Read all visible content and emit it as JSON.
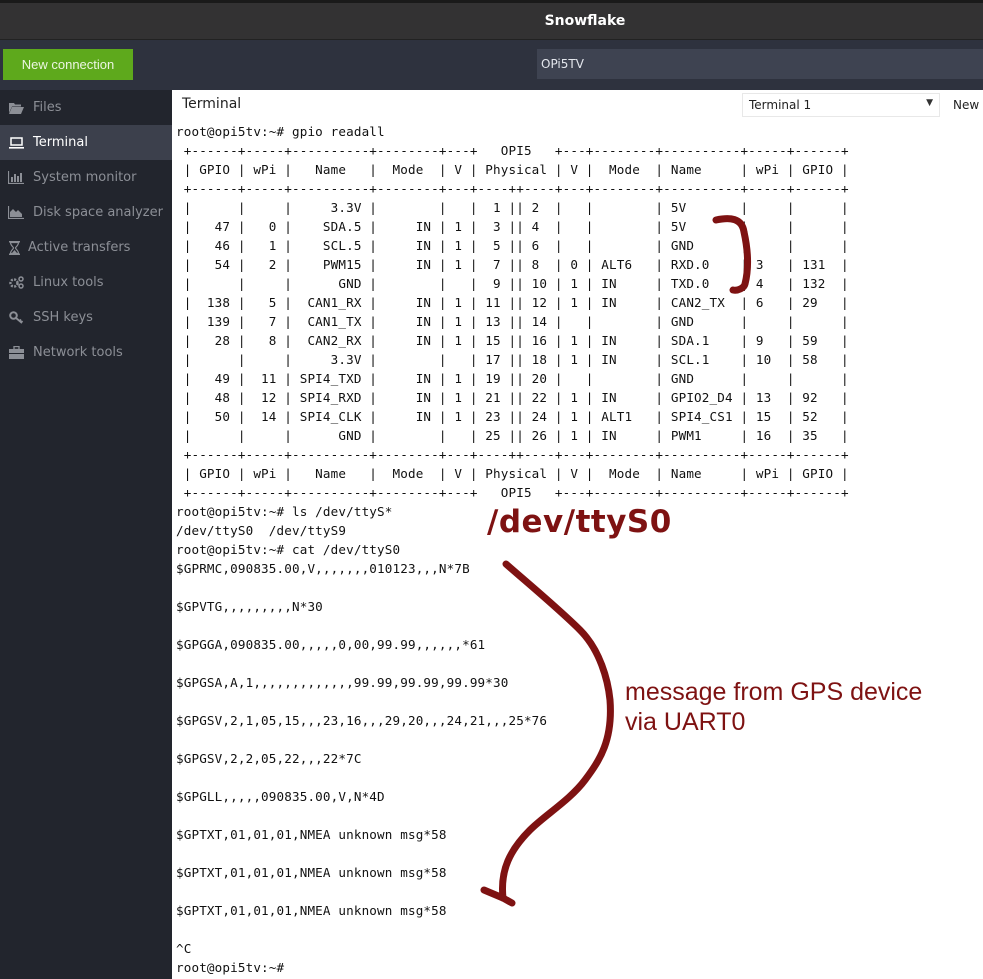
{
  "window": {
    "title": "Snowflake"
  },
  "toolbar": {
    "new_connection_label": "New connection",
    "session_name": "OPi5TV"
  },
  "sidebar": {
    "items": [
      {
        "label": "Files",
        "icon": "folder-open-icon",
        "active": false
      },
      {
        "label": "Terminal",
        "icon": "laptop-icon",
        "active": true
      },
      {
        "label": "System monitor",
        "icon": "bar-chart-icon",
        "active": false
      },
      {
        "label": "Disk space analyzer",
        "icon": "area-chart-icon",
        "active": false
      },
      {
        "label": "Active transfers",
        "icon": "hourglass-icon",
        "active": false
      },
      {
        "label": "Linux tools",
        "icon": "gears-icon",
        "active": false
      },
      {
        "label": "SSH keys",
        "icon": "key-icon",
        "active": false
      },
      {
        "label": "Network tools",
        "icon": "briefcase-icon",
        "active": false
      }
    ]
  },
  "main": {
    "tab_title": "Terminal",
    "terminal_select": "Terminal 1",
    "new_terminal_label": "New"
  },
  "terminal": {
    "lines": [
      "root@opi5tv:~# gpio readall",
      " +------+-----+----------+--------+---+   OPI5   +---+--------+----------+-----+------+",
      " | GPIO | wPi |   Name   |  Mode  | V | Physical | V |  Mode  | Name     | wPi | GPIO |",
      " +------+-----+----------+--------+---+----++----+---+--------+----------+-----+------+",
      " |      |     |     3.3V |        |   |  1 || 2  |   |        | 5V       |     |      |",
      " |   47 |   0 |    SDA.5 |     IN | 1 |  3 || 4  |   |        | 5V       |     |      |",
      " |   46 |   1 |    SCL.5 |     IN | 1 |  5 || 6  |   |        | GND      |     |      |",
      " |   54 |   2 |    PWM15 |     IN | 1 |  7 || 8  | 0 | ALT6   | RXD.0    | 3   | 131  |",
      " |      |     |      GND |        |   |  9 || 10 | 1 | IN     | TXD.0    | 4   | 132  |",
      " |  138 |   5 |  CAN1_RX |     IN | 1 | 11 || 12 | 1 | IN     | CAN2_TX  | 6   | 29   |",
      " |  139 |   7 |  CAN1_TX |     IN | 1 | 13 || 14 |   |        | GND      |     |      |",
      " |   28 |   8 |  CAN2_RX |     IN | 1 | 15 || 16 | 1 | IN     | SDA.1    | 9   | 59   |",
      " |      |     |     3.3V |        |   | 17 || 18 | 1 | IN     | SCL.1    | 10  | 58   |",
      " |   49 |  11 | SPI4_TXD |     IN | 1 | 19 || 20 |   |        | GND      |     |      |",
      " |   48 |  12 | SPI4_RXD |     IN | 1 | 21 || 22 | 1 | IN     | GPIO2_D4 | 13  | 92   |",
      " |   50 |  14 | SPI4_CLK |     IN | 1 | 23 || 24 | 1 | ALT1   | SPI4_CS1 | 15  | 52   |",
      " |      |     |      GND |        |   | 25 || 26 | 1 | IN     | PWM1     | 16  | 35   |",
      " +------+-----+----------+--------+---+----++----+---+--------+----------+-----+------+",
      " | GPIO | wPi |   Name   |  Mode  | V | Physical | V |  Mode  | Name     | wPi | GPIO |",
      " +------+-----+----------+--------+---+   OPI5   +---+--------+----------+-----+------+",
      "root@opi5tv:~# ls /dev/ttyS*",
      "/dev/ttyS0  /dev/ttyS9",
      "root@opi5tv:~# cat /dev/ttyS0",
      "$GPRMC,090835.00,V,,,,,,,010123,,,N*7B",
      "",
      "$GPVTG,,,,,,,,,N*30",
      "",
      "$GPGGA,090835.00,,,,,0,00,99.99,,,,,,*61",
      "",
      "$GPGSA,A,1,,,,,,,,,,,,,99.99,99.99,99.99*30",
      "",
      "$GPGSV,2,1,05,15,,,23,16,,,29,20,,,24,21,,,25*76",
      "",
      "$GPGSV,2,2,05,22,,,22*7C",
      "",
      "$GPGLL,,,,,090835.00,V,N*4D",
      "",
      "$GPTXT,01,01,01,NMEA unknown msg*58",
      "",
      "$GPTXT,01,01,01,NMEA unknown msg*58",
      "",
      "$GPTXT,01,01,01,NMEA unknown msg*58",
      "",
      "^C",
      "root@opi5tv:~#"
    ]
  },
  "annotations": {
    "device_label": "/dev/ttyS0",
    "message_line1": "message from GPS device",
    "message_line2": "via UART0",
    "color": "#7e1212"
  }
}
